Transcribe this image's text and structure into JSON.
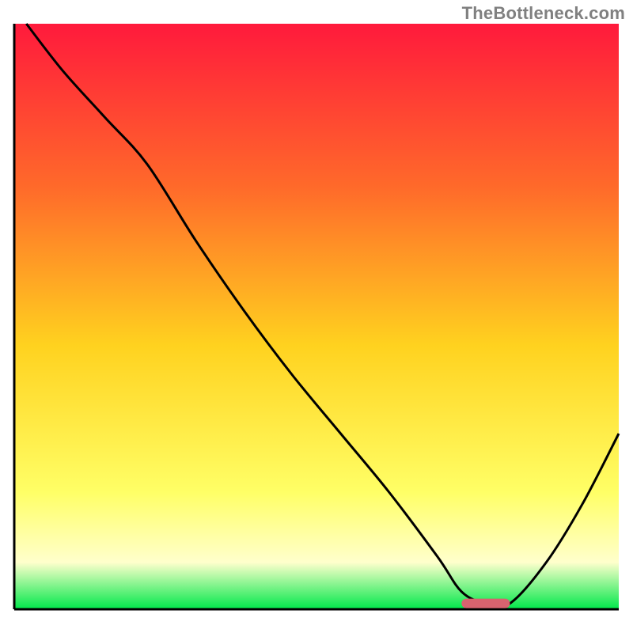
{
  "watermark": "TheBottleneck.com",
  "colors": {
    "gradient_top": "#ff1a3c",
    "gradient_mid_upper": "#ff6a2a",
    "gradient_mid": "#ffd21f",
    "gradient_lower": "#ffff66",
    "gradient_pale": "#ffffcc",
    "gradient_green": "#00e84a",
    "line": "#000000",
    "marker": "#d9636f",
    "axis": "#000000"
  },
  "chart_data": {
    "type": "line",
    "title": "",
    "xlabel": "",
    "ylabel": "",
    "xlim": [
      0,
      100
    ],
    "ylim": [
      0,
      100
    ],
    "x": [
      2,
      8,
      15,
      22,
      30,
      38,
      46,
      54,
      62,
      70,
      74,
      78,
      82,
      88,
      94,
      100
    ],
    "values": [
      100,
      92,
      84,
      76,
      63,
      51,
      40,
      30,
      20,
      9,
      3,
      1,
      1,
      8,
      18,
      30
    ],
    "marker": {
      "x_start": 74,
      "x_end": 82,
      "y": 1
    },
    "annotations": []
  }
}
